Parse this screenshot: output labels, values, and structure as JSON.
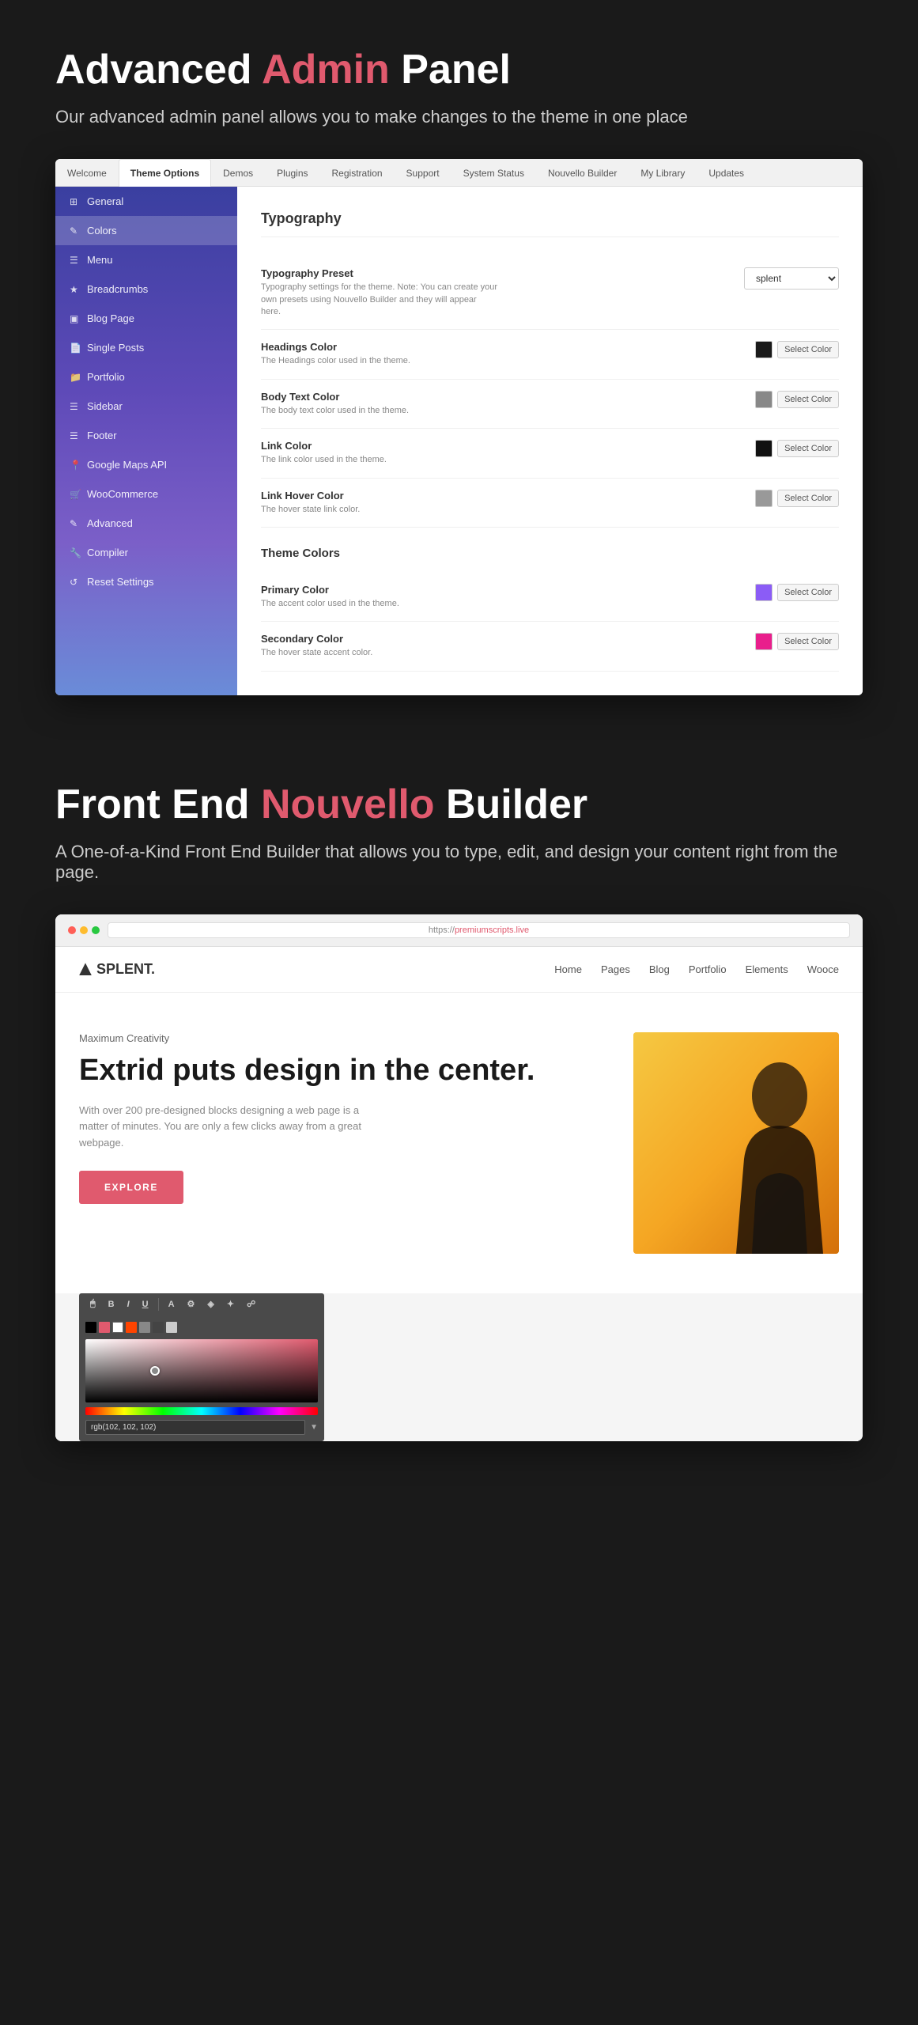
{
  "section1": {
    "title_part1": "Advanced ",
    "title_part2": "Admin",
    "title_part3": " Panel",
    "subtitle": "Our advanced admin panel allows you to make changes to the theme in one place",
    "tabs": [
      {
        "label": "Welcome",
        "active": false
      },
      {
        "label": "Theme Options",
        "active": true
      },
      {
        "label": "Demos",
        "active": false
      },
      {
        "label": "Plugins",
        "active": false
      },
      {
        "label": "Registration",
        "active": false
      },
      {
        "label": "Support",
        "active": false
      },
      {
        "label": "System Status",
        "active": false
      },
      {
        "label": "Nouvello Builder",
        "active": false
      },
      {
        "label": "My Library",
        "active": false
      },
      {
        "label": "Updates",
        "active": false
      }
    ],
    "sidebar": {
      "items": [
        {
          "label": "General",
          "icon": "⊞",
          "active": false
        },
        {
          "label": "Colors",
          "icon": "✎",
          "active": true
        },
        {
          "label": "Menu",
          "icon": "☰",
          "active": false
        },
        {
          "label": "Breadcrumbs",
          "icon": "★",
          "active": false
        },
        {
          "label": "Blog Page",
          "icon": "▣",
          "active": false
        },
        {
          "label": "Single Posts",
          "icon": "📄",
          "active": false
        },
        {
          "label": "Portfolio",
          "icon": "📁",
          "active": false
        },
        {
          "label": "Sidebar",
          "icon": "☰",
          "active": false
        },
        {
          "label": "Footer",
          "icon": "☰",
          "active": false
        },
        {
          "label": "Google Maps API",
          "icon": "📍",
          "active": false
        },
        {
          "label": "WooCommerce",
          "icon": "🛒",
          "active": false
        },
        {
          "label": "Advanced",
          "icon": "✎",
          "active": false
        },
        {
          "label": "Compiler",
          "icon": "🔧",
          "active": false
        },
        {
          "label": "Reset Settings",
          "icon": "↺",
          "active": false
        }
      ]
    },
    "main": {
      "section_title": "Typography",
      "typography_preset_label": "Typography Preset",
      "typography_preset_desc": "Typography settings for the theme. Note: You can create your own presets using Nouvello Builder and they will appear here.",
      "preset_value": "splent",
      "headings_color_label": "Headings Color",
      "headings_color_desc": "The Headings color used in the theme.",
      "body_text_color_label": "Body Text Color",
      "body_text_color_desc": "The body text color used in the theme.",
      "link_color_label": "Link Color",
      "link_color_desc": "The link color used in the theme.",
      "link_hover_color_label": "Link Hover Color",
      "link_hover_color_desc": "The hover state link color.",
      "theme_colors_title": "Theme Colors",
      "primary_color_label": "Primary Color",
      "primary_color_desc": "The accent color used in the theme.",
      "secondary_color_label": "Secondary Color",
      "secondary_color_desc": "The hover state accent color.",
      "select_color_btn": "Select Color",
      "headings_swatch": "#1a1a1a",
      "body_swatch": "#888888",
      "link_swatch": "#111111",
      "link_hover_swatch": "#999999",
      "primary_swatch": "#8b5cf6",
      "secondary_swatch": "#e91e8c"
    }
  },
  "section2": {
    "title_part1": "Front End ",
    "title_part2": "Nouvello",
    "title_part3": " Builder",
    "subtitle": "A One-of-a-Kind Front End Builder that allows you to type, edit, and design your content right from the page.",
    "browser": {
      "url_prefix": "https://",
      "url_domain": "premiumscripts.live"
    },
    "website": {
      "logo": "SPLENT.",
      "nav_links": [
        "Home",
        "Pages",
        "Blog",
        "Portfolio",
        "Elements",
        "Wooce"
      ],
      "hero_label": "Maximum Creativity",
      "hero_title": "Extrid puts design in the center.",
      "hero_desc": "With over 200 pre-designed blocks designing a web page is a matter of minutes. You are only a few clicks away from a great webpage.",
      "hero_btn": "EXPLORE"
    },
    "toolbar": {
      "buttons": [
        "T",
        "B",
        "I",
        "U",
        "A",
        "⚙",
        "◈",
        "✦",
        "☍"
      ],
      "color_swatches": [
        "#000000",
        "#e05a6e",
        "#ffffff",
        "#ff0000",
        "#888888",
        "#444444",
        "#cccccc"
      ],
      "color_input_value": "rgb(102, 102, 102)"
    }
  }
}
